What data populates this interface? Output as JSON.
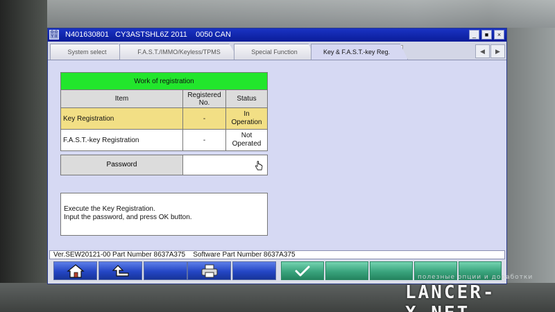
{
  "window": {
    "title": "N401630801   CY3ASTSHL6Z 2011    0050 CAN",
    "icon_text": "0 0 Y\nII",
    "controls": [
      "_",
      "■",
      "×"
    ]
  },
  "tabs": [
    {
      "label": "System select"
    },
    {
      "label": "F.A.S.T./IMMO/Keyless/TPMS"
    },
    {
      "label": "Special Function"
    },
    {
      "label": "Key & F.A.S.T.-key Reg.",
      "active": true,
      "close": "×"
    }
  ],
  "tab_nav": {
    "prev": "◀",
    "next": "▶"
  },
  "registration": {
    "header": "Work of registration",
    "columns": [
      "Item",
      "Registered No.",
      "Status"
    ],
    "rows": [
      {
        "item": "Key Registration",
        "registered_no": "-",
        "status": "In Operation",
        "highlight": "#f2df85"
      },
      {
        "item": "F.A.S.T.-key Registration",
        "registered_no": "-",
        "status": "Not Operated",
        "highlight": "#ffffff"
      }
    ],
    "header_color": "#22e62c"
  },
  "password": {
    "label": "Password",
    "value": ""
  },
  "message": {
    "line1": "Execute the Key Registration.",
    "line2": "Input the password, and press OK button."
  },
  "version_bar": "Ver.SEW20121-00 Part Number 8637A375    Software Part Number 8637A375",
  "toolbar": {
    "buttons": [
      {
        "name": "home",
        "icon": "home-icon"
      },
      {
        "name": "back",
        "icon": "return-arrow-icon"
      },
      {
        "name": "blank-1"
      },
      {
        "name": "print",
        "icon": "printer-icon"
      },
      {
        "name": "blank-2"
      },
      {
        "name": "ok",
        "icon": "checkmark-icon",
        "color": "#3aa47d"
      },
      {
        "name": "blank-3"
      },
      {
        "name": "blank-4"
      },
      {
        "name": "blank-5"
      },
      {
        "name": "blank-6"
      }
    ]
  },
  "watermark": {
    "sub": "полезные опции и доработки",
    "main": "LANCER-X.NET"
  }
}
